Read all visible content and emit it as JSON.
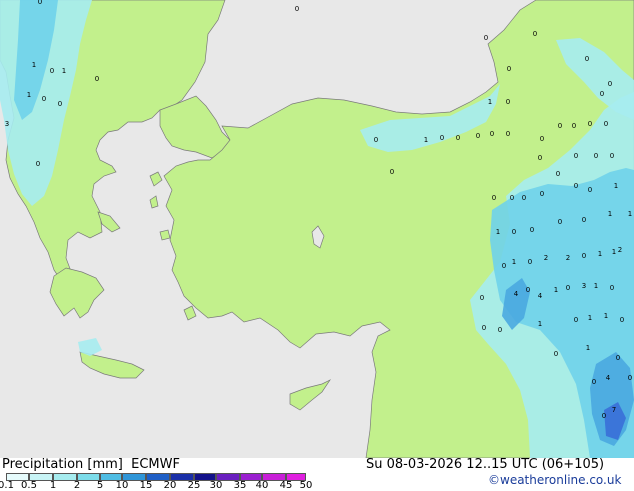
{
  "map": {
    "colors": {
      "sea": "#e8e8e8",
      "land": "#c2f08c",
      "precip_light": "#a6ecef",
      "precip_mid": "#6fd2ea",
      "precip_heavy": "#4aa8e0",
      "precip_strong": "#3a6fd8",
      "coast": "#7a7a7a"
    },
    "point_values": [
      "0",
      "0",
      "0",
      "0",
      "1",
      "0",
      "1",
      "0",
      "1",
      "0",
      "3",
      "0",
      "0",
      "0",
      "0",
      "0",
      "0",
      "0",
      "0",
      "0",
      "1",
      "0",
      "0",
      "0",
      "0",
      "0",
      "0",
      "0",
      "0",
      "0",
      "0",
      "0",
      "0",
      "0",
      "0",
      "0",
      "0",
      "1",
      "0",
      "0",
      "0",
      "0",
      "1",
      "1",
      "0",
      "0",
      "0",
      "0",
      "1",
      "1",
      "0",
      "1",
      "0",
      "2",
      "2",
      "0",
      "1",
      "1",
      "2",
      "0",
      "4",
      "0",
      "4",
      "1",
      "0",
      "3",
      "1",
      "0",
      "0",
      "0",
      "1",
      "0",
      "1",
      "1",
      "0",
      "1",
      "4",
      "0",
      "7",
      "0",
      "0",
      "0",
      "0",
      "0"
    ]
  },
  "footer": {
    "title": "Precipitation [mm]  ECMWF",
    "datetime": "Su 08-03-2026 12..15 UTC (06+105)",
    "credit": "©weatheronline.co.uk"
  },
  "legend": {
    "labels": [
      "0.1",
      "0.5",
      "1",
      "2",
      "5",
      "10",
      "15",
      "20",
      "25",
      "30",
      "35",
      "40",
      "45",
      "50"
    ],
    "colors": [
      "#ffffff",
      "#e6fbfc",
      "#c8f4f6",
      "#a6ecef",
      "#7cdcea",
      "#4fbde4",
      "#3096d8",
      "#1f5fc6",
      "#1a2fa8",
      "#13128a",
      "#6a1fc0",
      "#9a1fd0",
      "#c81fd8",
      "#e01fe0"
    ]
  }
}
